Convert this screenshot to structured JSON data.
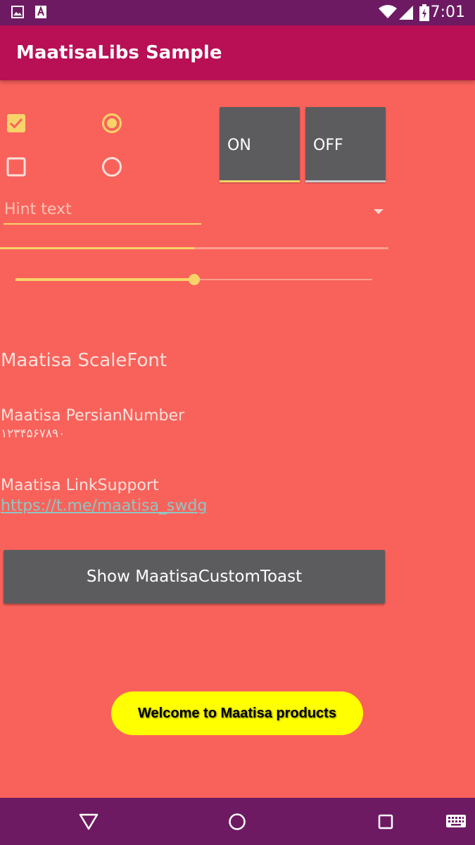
{
  "status_bar": {
    "time": "7:01",
    "icons": [
      "image-icon",
      "a-notification-icon",
      "wifi-icon",
      "signal-icon",
      "battery-icon"
    ]
  },
  "app_bar": {
    "title": "MaatisaLibs Sample"
  },
  "checkboxes": [
    {
      "checked": true
    },
    {
      "checked": false
    }
  ],
  "radios": [
    {
      "selected": true
    },
    {
      "selected": false
    }
  ],
  "toggles": [
    {
      "label": "ON",
      "state": true
    },
    {
      "label": "OFF",
      "state": false
    }
  ],
  "spinner": {
    "hint": "Hint text"
  },
  "progress": {
    "value": 0.5
  },
  "seekbar": {
    "value": 0.5
  },
  "texts": {
    "scale_font": "Maatisa ScaleFont",
    "persian_label": "Maatisa PersianNumber",
    "persian_digits": "۱۲۳۴۵۶۷۸۹۰",
    "link_label": "Maatisa LinkSupport",
    "link_url": "https://t.me/maatisa_swdg"
  },
  "toast_button": {
    "label": "Show MaatisaCustomToast"
  },
  "toast": {
    "message": "Welcome to Maatisa products"
  },
  "nav_bar": {
    "icons": [
      "back-icon",
      "home-icon",
      "recents-icon",
      "keyboard-icon"
    ]
  },
  "colors": {
    "accent": "#f8d369",
    "background": "#f9625b",
    "app_bar": "#b80f55",
    "status_bar": "#6e1a63",
    "button": "#5c5c5e",
    "toast": "#ffff00"
  }
}
